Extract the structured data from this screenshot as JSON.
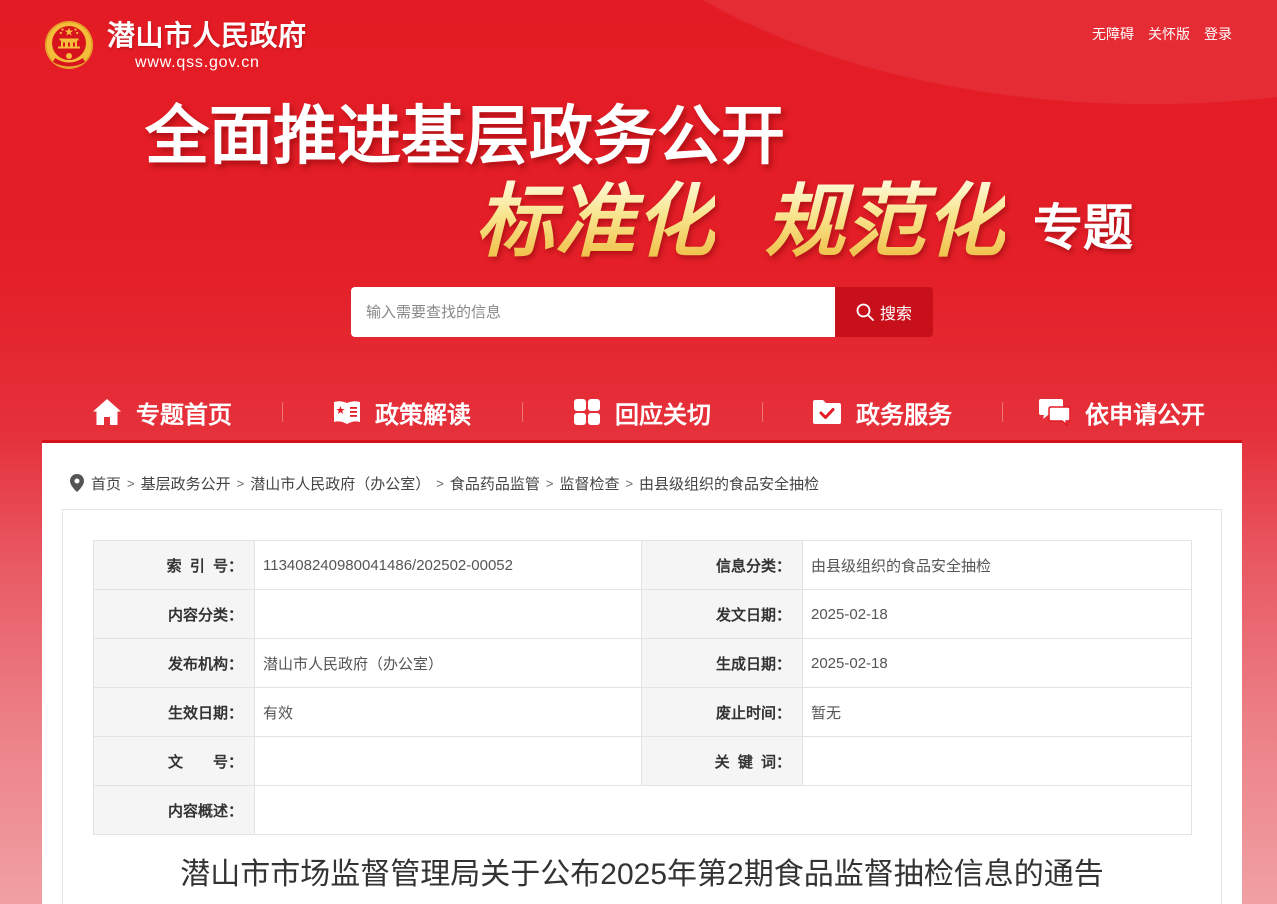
{
  "site": {
    "title": "潜山市人民政府",
    "domain": "www.qss.gov.cn",
    "emblem_icon": "national-emblem-icon"
  },
  "top_links": [
    {
      "label": "无障碍"
    },
    {
      "label": "关怀版"
    },
    {
      "label": "登录"
    }
  ],
  "banner": {
    "heading": "全面推进基层政务公开",
    "highlight_1": "标准化",
    "highlight_2": "规范化",
    "suffix": "专题"
  },
  "search": {
    "placeholder": "输入需要查找的信息",
    "button_label": "搜索",
    "button_icon": "search-icon"
  },
  "nav": [
    {
      "label": "专题首页",
      "icon": "home-icon"
    },
    {
      "label": "政策解读",
      "icon": "book-icon"
    },
    {
      "label": "回应关切",
      "icon": "grid-icon"
    },
    {
      "label": "政务服务",
      "icon": "folder-check-icon"
    },
    {
      "label": "依申请公开",
      "icon": "chat-icon"
    }
  ],
  "breadcrumb": {
    "icon": "location-pin-icon",
    "separator": ">",
    "items": [
      "首页",
      "基层政务公开",
      "潜山市人民政府（办公室）",
      "食品药品监管",
      "监督检查",
      "由县级组织的食品安全抽检"
    ]
  },
  "info_table": {
    "rows": [
      {
        "left_label": "索 引 号：",
        "left_value": "113408240980041486/202502-00052",
        "right_label": "信息分类：",
        "right_value": "由县级组织的食品安全抽检"
      },
      {
        "left_label": "内容分类：",
        "left_value": "",
        "right_label": "发文日期：",
        "right_value": "2025-02-18"
      },
      {
        "left_label": "发布机构：",
        "left_value": "潜山市人民政府（办公室）",
        "right_label": "生成日期：",
        "right_value": "2025-02-18"
      },
      {
        "left_label": "生效日期：",
        "left_value": "有效",
        "right_label": "废止时间：",
        "right_value": "暂无"
      },
      {
        "left_label": "文　　号：",
        "left_value": "",
        "right_label": "关 键 词：",
        "right_value": ""
      }
    ],
    "summary": {
      "label": "内容概述：",
      "value": ""
    }
  },
  "article": {
    "title": "潜山市市场监督管理局关于公布2025年第2期食品监督抽检信息的通告"
  },
  "colors": {
    "brand_red": "#e31b24",
    "nav_underline": "#d3121d",
    "search_button": "#c8101a",
    "banner_highlight": "#f8e48c"
  }
}
